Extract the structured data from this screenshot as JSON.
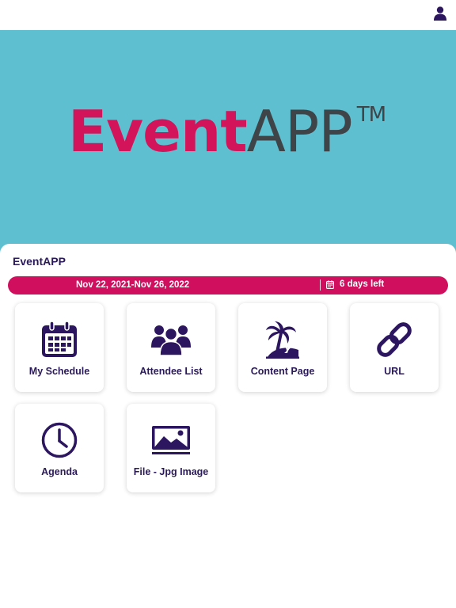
{
  "colors": {
    "banner": "#5dbfcf",
    "accent": "#d0105e",
    "logo_pink": "#d4145a",
    "logo_gray": "#3f4448",
    "icon": "#2d1660",
    "text": "#2b1a5a"
  },
  "header": {
    "profile_icon": "person-icon"
  },
  "banner": {
    "logo_part1": "Event",
    "logo_part2": "APP",
    "logo_mark": "TM"
  },
  "event": {
    "title": "EventAPP",
    "date_range": "Nov 22, 2021-Nov 26, 2022",
    "days_left": "6 days left"
  },
  "tiles": [
    {
      "label": "My Schedule",
      "icon": "calendar-icon"
    },
    {
      "label": "Attendee List",
      "icon": "group-icon"
    },
    {
      "label": "Content Page",
      "icon": "palm-island-icon"
    },
    {
      "label": "URL",
      "icon": "link-icon"
    },
    {
      "label": "Agenda",
      "icon": "clock-icon"
    },
    {
      "label": "File - Jpg Image",
      "icon": "image-icon"
    }
  ]
}
